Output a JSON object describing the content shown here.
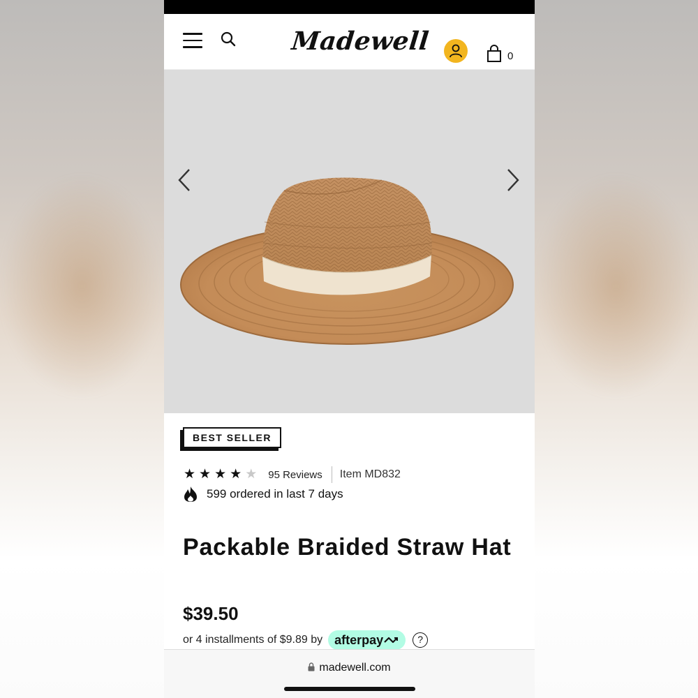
{
  "header": {
    "logo_text": "Madewell",
    "bag_count": "0",
    "account_color": "#f2b51f"
  },
  "product": {
    "badge": "BEST SELLER",
    "rating": 4,
    "rating_max": 5,
    "reviews": "95 Reviews",
    "item_number": "Item MD832",
    "ordered_text": "599 ordered in last 7 days",
    "title": "Packable Braided Straw Hat",
    "price": "$39.50",
    "installments_text": "or 4 installments of $9.89 by",
    "afterpay_label": "afterpay",
    "afterpay_color": "#b2fce4",
    "help_icon": "?"
  },
  "gallery": {
    "prev_icon": "chevron-left-icon",
    "next_icon": "chevron-right-icon"
  },
  "browser": {
    "url": "madewell.com"
  }
}
